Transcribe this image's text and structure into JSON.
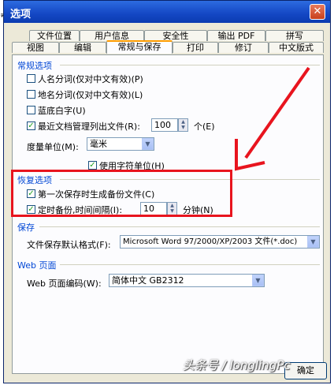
{
  "window": {
    "title": "选项",
    "close_label": "✕"
  },
  "tabs_row1": [
    "文件位置",
    "用户信息",
    "安全性",
    "输出 PDF",
    "拼写"
  ],
  "tabs_row2": [
    "视图",
    "编辑",
    "常规与保存",
    "打印",
    "修订",
    "中文版式"
  ],
  "general": {
    "title": "常规选项",
    "options": [
      {
        "label": "人名分词(仅对中文有效)(P)",
        "checked": false
      },
      {
        "label": "地名分词(仅对中文有效)(L)",
        "checked": false
      },
      {
        "label": "蓝底白字(U)",
        "checked": false
      }
    ],
    "recent_files": {
      "label": "最近文档管理列出文件(R):",
      "checked": true,
      "value": "100",
      "unit": "个(E)"
    },
    "measure": {
      "label": "度量单位(M):",
      "value": "毫米"
    },
    "char_unit": {
      "label": "使用字符单位(H)",
      "checked": true
    }
  },
  "recovery": {
    "title": "恢复选项",
    "backup": {
      "label": "第一次保存时生成备份文件(C)",
      "checked": true
    },
    "timed": {
      "label": "定时备份,时间间隔(I):",
      "checked": true,
      "value": "10",
      "unit": "分钟(N)"
    }
  },
  "save": {
    "title": "保存",
    "format_label": "文件保存默认格式(F):",
    "format_value": "Microsoft Word 97/2000/XP/2003 文件(*.doc)"
  },
  "web": {
    "title": "Web 页面",
    "encoding_label": "Web 页面编码(W):",
    "encoding_value": "简体中文 GB2312"
  },
  "footer": {
    "ok_label": "确定",
    "watermark": "头条号 / longlingPc"
  },
  "colors": {
    "annotation_red": "#E8141E",
    "section_blue": "#0046D5",
    "titlebar_blue": "#1447C4"
  }
}
